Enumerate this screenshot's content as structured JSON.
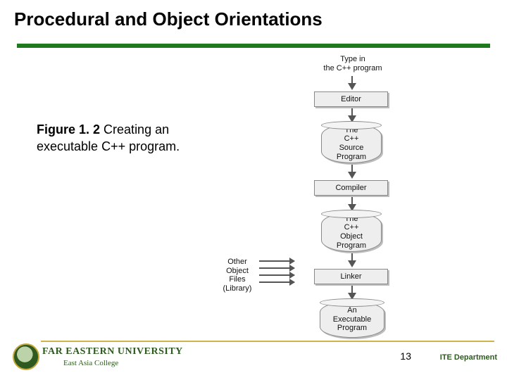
{
  "title": "Procedural and Object Orientations",
  "caption": {
    "fig": "Figure 1. 2",
    "text": "Creating an executable C++ program."
  },
  "diagram": {
    "start": "Type in\nthe C++ program",
    "editor": "Editor",
    "source": "The\nC++\nSource\nProgram",
    "compiler": "Compiler",
    "object": "The\nC++\nObject\nProgram",
    "linker": "Linker",
    "exe": "An\nExecutable\nProgram",
    "lib": "Other\nObject\nFiles\n(Library)"
  },
  "footer": {
    "university": "FAR EASTERN UNIVERSITY",
    "college": "East Asia College",
    "page": "13",
    "dept": "ITE Department"
  }
}
